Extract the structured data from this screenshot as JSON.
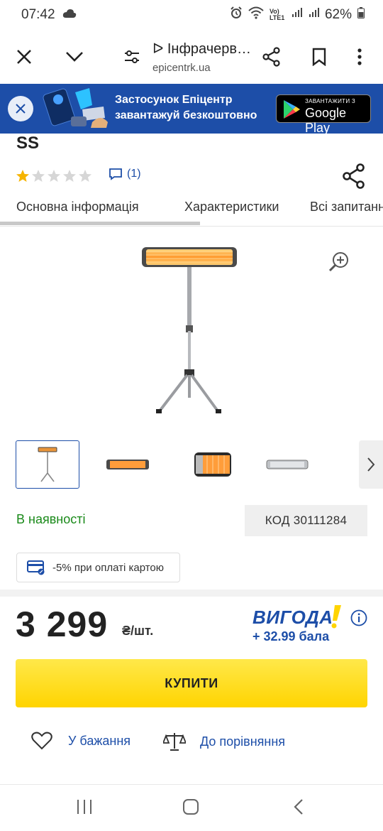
{
  "status_bar": {
    "time": "07:42",
    "battery": "62%",
    "network_label": "Vo) LTE1"
  },
  "browser": {
    "page_title": "ᐅ Інфрачерв…",
    "host": "epicentrk.ua",
    "icons": [
      "close-icon",
      "chevron-down-icon",
      "tune-icon",
      "share-icon",
      "bookmark-icon",
      "more-vert-icon"
    ]
  },
  "promo_banner": {
    "line1": "Застосунок Епіцентр",
    "line2": "завантажуй безкоштовно",
    "store_small": "ЗАВАНТАЖИТИ З",
    "store_big": "Google Play",
    "brand_color": "#1d4ea8"
  },
  "product": {
    "title_tail": "SS",
    "rating": 1,
    "rating_max": 5,
    "reviews_count": "(1)",
    "tabs": [
      "Основна інформація",
      "Характеристики",
      "Всі запитання"
    ],
    "active_tab": 0,
    "thumbnails": [
      "heater-on-tripod",
      "heater-front",
      "heater-angle",
      "heater-silver"
    ],
    "active_thumbnail": 0,
    "availability": "В наявності",
    "code": "КОД 30111284",
    "card_promo": "-5% при оплаті картою",
    "price": "3 299",
    "price_unit": "₴/шт.",
    "bonus_title": "ВИГОДА",
    "bonus_amount": "+ 32.99 бала",
    "buy_label": "КУПИТИ",
    "wishlist_label": "У бажання",
    "compare_label": "До порівняння",
    "accent_color": "#ffd400",
    "stock_color": "#1a8a1a"
  }
}
